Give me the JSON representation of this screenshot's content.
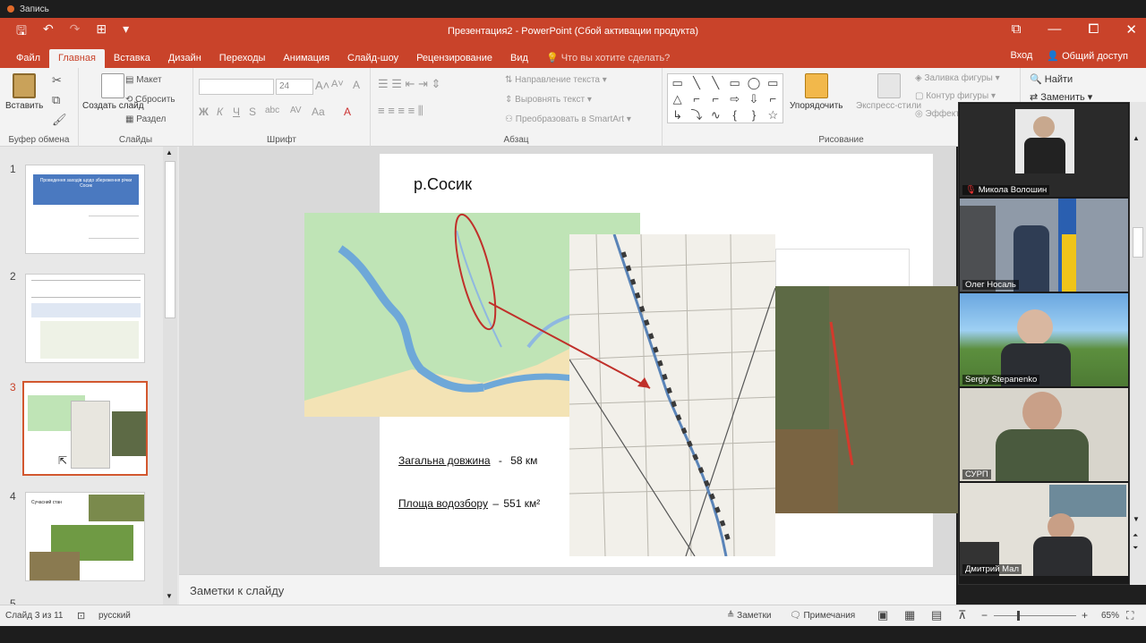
{
  "recorder": {
    "label": "Запись"
  },
  "window": {
    "title": "Презентация2 - PowerPoint (Сбой активации продукта)"
  },
  "qat": {
    "save": "🖫",
    "undo": "↶",
    "redo": "↷",
    "start": "⊞",
    "more": "▾"
  },
  "winctl": {
    "ribbon": "⧉",
    "minimize": "—",
    "restore": "⧠",
    "close": "✕"
  },
  "tabs": [
    "Файл",
    "Главная",
    "Вставка",
    "Дизайн",
    "Переходы",
    "Анимация",
    "Слайд-шоу",
    "Рецензирование",
    "Вид"
  ],
  "active_tab": "Главная",
  "tell_me": "Что вы хотите сделать?",
  "tabs_right": {
    "login": "Вход",
    "share": "Общий доступ"
  },
  "ribbon": {
    "clipboard": {
      "paste": "Вставить",
      "label": "Буфер обмена"
    },
    "slides": {
      "new_slide": "Создать слайд",
      "layout": "Макет",
      "reset": "Сбросить",
      "section": "Раздел",
      "label": "Слайды"
    },
    "font": {
      "size": "24",
      "label": "Шрифт",
      "bold": "Ж",
      "italic": "К",
      "underline": "Ч",
      "strike": "S",
      "shadow": "аbc",
      "spacing": "AV",
      "case": "Aa",
      "grow": "A˄",
      "shrink": "A˅",
      "clear": "A"
    },
    "paragraph": {
      "direction": "Направление текста",
      "align": "Выровнять текст",
      "smartart": "Преобразовать в SmartArt",
      "label": "Абзац"
    },
    "drawing": {
      "arrange": "Упорядочить",
      "styles": "Экспресс-стили",
      "fill": "Заливка фигуры",
      "outline": "Контур фигуры",
      "effects": "Эффекты",
      "label": "Рисование"
    },
    "editing": {
      "find": "Найти",
      "replace": "Заменить"
    }
  },
  "shapes": [
    "▭",
    "╲",
    "╲",
    "▭",
    "◯",
    "▭",
    "△",
    "⌐",
    "⌐",
    "⇨",
    "⇩",
    "⌐",
    "↳",
    "⤵",
    "∿",
    "{",
    "}",
    "☆"
  ],
  "thumbnails": [
    {
      "num": "1",
      "title": "Проведення заходів щодо збереження річки Сосик"
    },
    {
      "num": "2"
    },
    {
      "num": "3"
    },
    {
      "num": "4",
      "title": "Сучасний стан"
    },
    {
      "num": "5"
    }
  ],
  "slide": {
    "title": "р.Сосик",
    "stat1_label": "Загальна довжина",
    "stat1_sep": "-",
    "stat1_value": "58 км",
    "stat2_label": "Площа водозбору",
    "stat2_sep": "–",
    "stat2_value": "551 км²"
  },
  "notes": {
    "placeholder": "Заметки к слайду"
  },
  "status": {
    "slide": "Слайд 3 из 11",
    "lang": "русский",
    "notes": "Заметки",
    "comments": "Примечания",
    "zoom": "65%",
    "minus": "−",
    "plus": "+"
  },
  "participants": [
    {
      "name": "Микола Волошин"
    },
    {
      "name": "Олег Носаль"
    },
    {
      "name": "Sergiy Stepanenko"
    },
    {
      "name": "СУРП"
    },
    {
      "name": "Дмитрий Мал"
    }
  ],
  "colors": {
    "accent": "#c9432a",
    "ribbon": "#f3f3f3"
  }
}
